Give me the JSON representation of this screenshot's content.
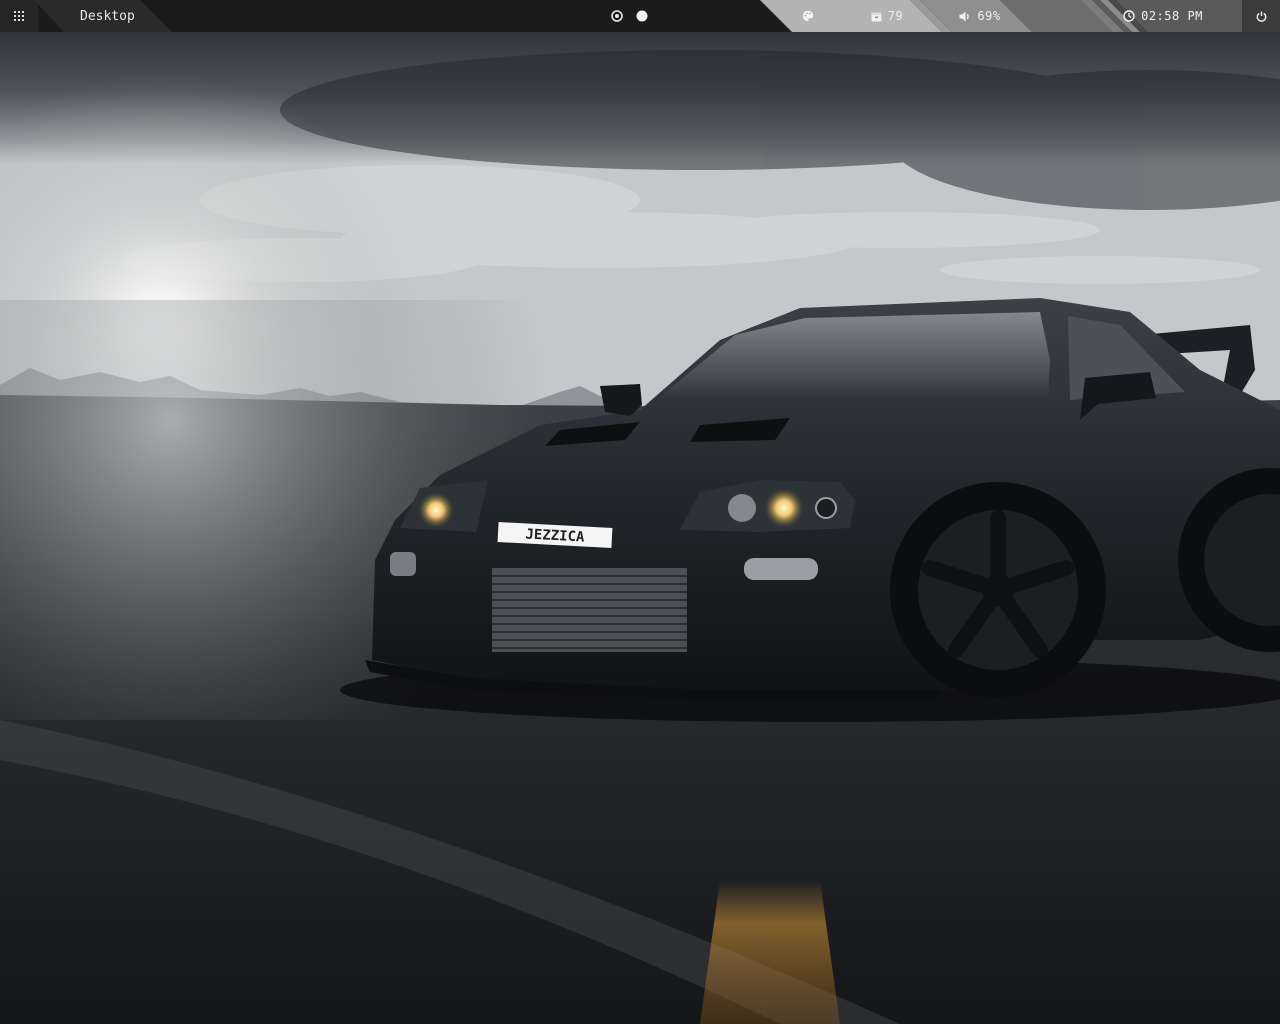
{
  "topbar": {
    "menu_icon": "grid-menu-icon",
    "workspace_title": "Desktop",
    "workspaces": [
      {
        "icon": "ring-dot-icon",
        "active": false
      },
      {
        "icon": "filled-circle-icon",
        "active": true
      }
    ],
    "modules": {
      "theme": {
        "icon": "palette-icon"
      },
      "updates": {
        "icon": "package-icon",
        "value": "79"
      },
      "volume": {
        "icon": "speaker-icon",
        "value": "69%"
      },
      "clock": {
        "icon": "clock-icon",
        "value": "02:58 PM"
      },
      "power": {
        "icon": "power-icon"
      }
    },
    "colors": {
      "bar": "#1b1b1b",
      "title_segment": "#2a2a2a",
      "module_light": "#b3b3b3",
      "module_mid": "#8f8f8f",
      "module_dark": "#5a5a5a",
      "text": "#dcdcdc"
    }
  },
  "wallpaper": {
    "license_plate": "JEZZICA",
    "subject": "black-sports-car-icon"
  }
}
